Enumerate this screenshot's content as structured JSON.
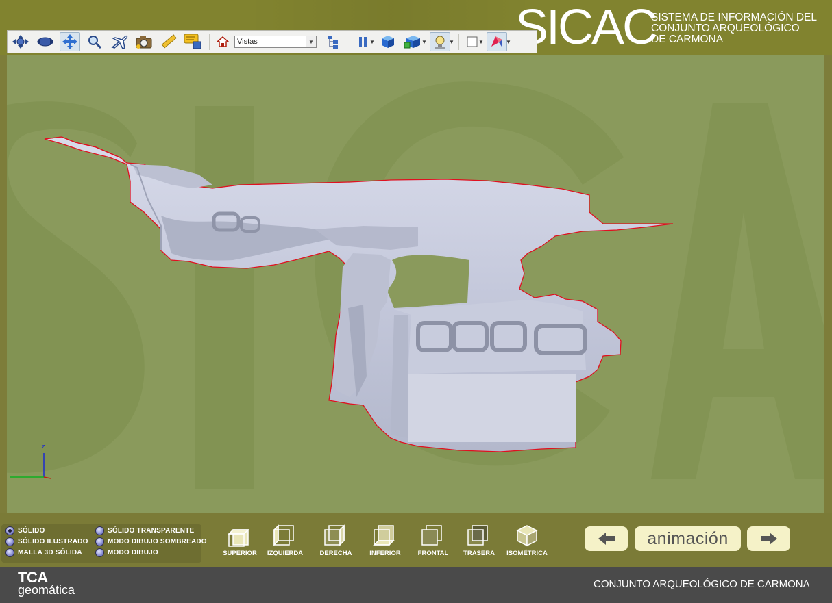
{
  "header": {
    "brand": "SICAC",
    "subtitle_lines": [
      "SISTEMA DE INFORMACIÓN  DEL",
      "CONJUNTO ARQUEOLÓGICO",
      "DE CARMONA"
    ]
  },
  "toolbar": {
    "tools": [
      {
        "name": "orbit-icon"
      },
      {
        "name": "rotate-icon"
      },
      {
        "name": "pan-icon",
        "active": true
      },
      {
        "name": "zoom-icon"
      },
      {
        "name": "fly-icon"
      },
      {
        "name": "camera-icon"
      },
      {
        "name": "measure-icon"
      },
      {
        "name": "comment-icon"
      },
      {
        "name": "home-icon"
      },
      {
        "name": "model-tree-icon"
      },
      {
        "name": "pause-icon"
      },
      {
        "name": "cube-icon"
      },
      {
        "name": "cube-set-icon"
      },
      {
        "name": "light-icon"
      },
      {
        "name": "background-color-icon"
      },
      {
        "name": "render-mode-icon"
      }
    ],
    "views_select_value": "Vistas"
  },
  "viewport": {
    "axis_label": "z",
    "watermark": "SICAC"
  },
  "render_modes": [
    {
      "label": "SÓLIDO",
      "selected": true
    },
    {
      "label": "SÓLIDO ILUSTRADO",
      "selected": false
    },
    {
      "label": "MALLA 3D SÓLIDA",
      "selected": false
    },
    {
      "label": "SÓLIDO TRANSPARENTE",
      "selected": false
    },
    {
      "label": "MODO DIBUJO SOMBREADO",
      "selected": false
    },
    {
      "label": "MODO DIBUJO",
      "selected": false
    }
  ],
  "view_buttons": [
    {
      "label": "SUPERIOR"
    },
    {
      "label": "IZQUIERDA"
    },
    {
      "label": "DERECHA"
    },
    {
      "label": "INFERIOR"
    },
    {
      "label": "FRONTAL"
    },
    {
      "label": "TRASERA"
    },
    {
      "label": "ISOMÉTRICA"
    }
  ],
  "navigation": {
    "prev": "previous-arrow",
    "animation_label": "animación",
    "next": "next-arrow"
  },
  "footer": {
    "logo_line1": "TCA",
    "logo_line2": "geomática",
    "title": "CONJUNTO ARQUEOLÓGICO DE CARMONA"
  },
  "colors": {
    "header_bg": "#81832f",
    "viewport_bg": "#8a9a5c",
    "model_fill": "#c9cde0",
    "model_outline": "#e01020",
    "footer_bg": "#4a4a4a",
    "nav_button_bg": "#f5f2c8"
  }
}
